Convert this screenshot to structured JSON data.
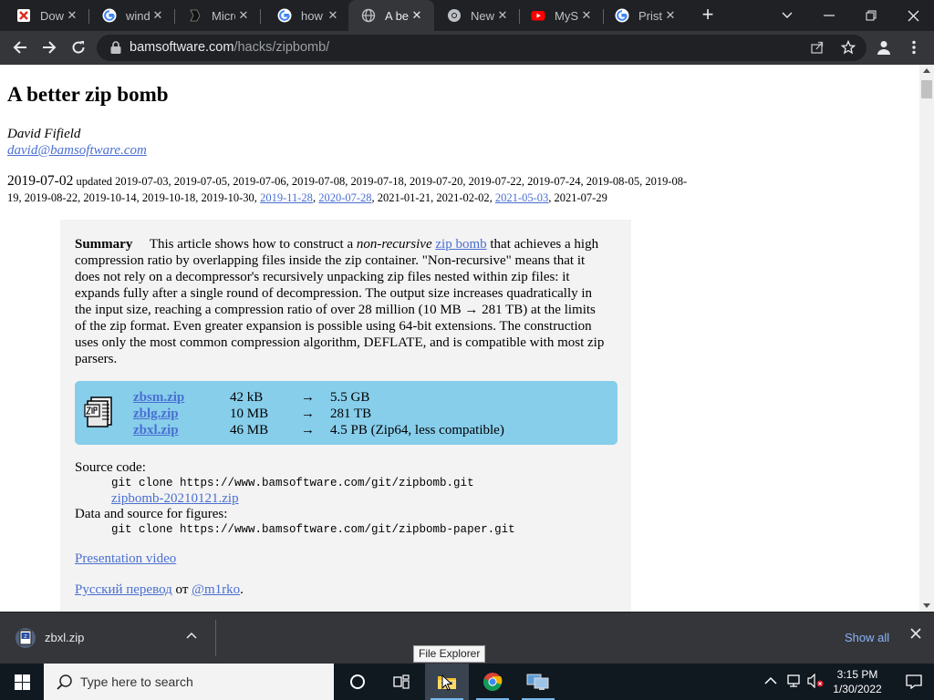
{
  "tabs": [
    {
      "title": "Down",
      "favicon": "download-red-icon"
    },
    {
      "title": "windo",
      "favicon": "google-icon"
    },
    {
      "title": "Micro",
      "favicon": "page-dark-icon"
    },
    {
      "title": "how t",
      "favicon": "google-icon"
    },
    {
      "title": "A bet",
      "favicon": "globe-icon",
      "active": true
    },
    {
      "title": "New",
      "favicon": "chrome-icon"
    },
    {
      "title": "MySc",
      "favicon": "youtube-icon"
    },
    {
      "title": "Pristi",
      "favicon": "google-icon"
    }
  ],
  "omnibox": {
    "domain": "bamsoftware.com",
    "path": "/hacks/zipbomb/"
  },
  "article": {
    "title": "A better zip bomb",
    "author": "David Fifield",
    "email": "david@bamsoftware.com",
    "date_main": "2019-07-02",
    "updated_label": "updated",
    "updates_plain_1": "2019-07-03, 2019-07-05, 2019-07-06, 2019-07-08, 2019-07-18, 2019-07-20, 2019-07-22, 2019-07-24, 2019-08-05,",
    "updates_plain_2": "2019-08-19, 2019-08-22, 2019-10-14, 2019-10-18, 2019-10-30,",
    "update_link_1": "2019-11-28",
    "update_link_2": "2020-07-28",
    "updates_plain_3": "2021-01-21, 2021-02-02,",
    "update_link_3": "2021-05-03",
    "updates_plain_4": "2021-07-29",
    "summary_label": "Summary",
    "summary_1": "This article shows how to construct a",
    "summary_em": "non-recursive",
    "summary_link": "zip bomb",
    "summary_2": "that achieves a high compression ratio by overlapping files inside the zip container. \"Non-recursive\" means that it does not rely on a decompressor's recursively unpacking zip files nested within zip files: it expands fully after a single round of decompression. The output size increases quadratically in the input size, reaching a compression ratio of over 28 million (10 MB → 281 TB) at the limits of the zip format. Even greater expansion is possible using 64-bit extensions. The construction uses only the most common compression algorithm, DEFLATE, and is compatible with most zip parsers.",
    "downloads": [
      {
        "name": "zbsm.zip",
        "size": "42 kB",
        "arrow": "→",
        "result": "5.5 GB"
      },
      {
        "name": "zblg.zip",
        "size": "10 MB",
        "arrow": "→",
        "result": "281 TB"
      },
      {
        "name": "zbxl.zip",
        "size": "46 MB",
        "arrow": "→",
        "result": "4.5 PB (Zip64, less compatible)"
      }
    ],
    "source_label": "Source code:",
    "source_git": "git clone https://www.bamsoftware.com/git/zipbomb.git",
    "source_zip": "zipbomb-20210121.zip",
    "data_label": "Data and source for figures:",
    "data_git": "git clone https://www.bamsoftware.com/git/zipbomb-paper.git",
    "presentation": "Presentation video",
    "russian_link": "Русский перевод",
    "russian_ot": "от",
    "russian_author": "@m1rko",
    "russian_end": "."
  },
  "download_shelf": {
    "file": "zbxl.zip",
    "show_all": "Show all"
  },
  "taskbar": {
    "search_placeholder": "Type here to search",
    "tooltip": "File Explorer",
    "time": "3:15 PM",
    "date": "1/30/2022"
  }
}
